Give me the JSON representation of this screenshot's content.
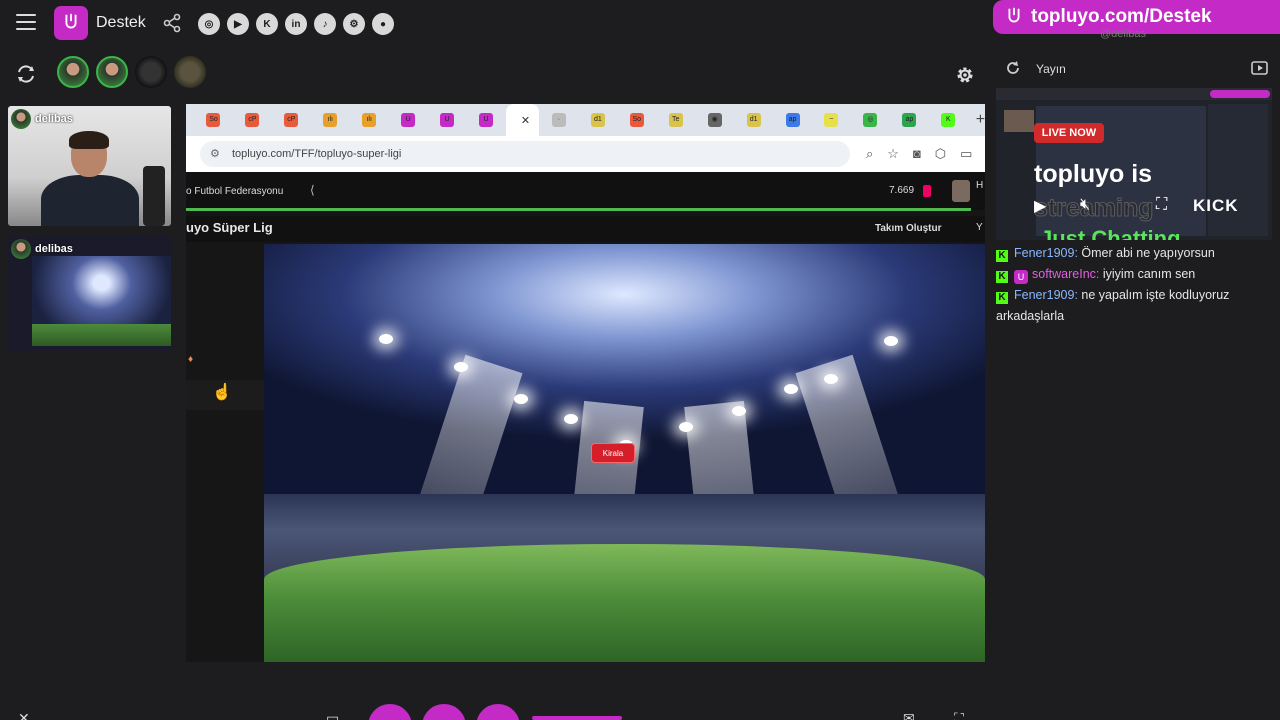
{
  "header": {
    "brand": "Destek",
    "social_icons": [
      "instagram-icon",
      "youtube-icon",
      "kick-icon",
      "linkedin-icon",
      "tiktok-icon",
      "steam-icon",
      "github-icon"
    ],
    "social_glyphs": [
      "◎",
      "▶",
      "K",
      "in",
      "♪",
      "⚙",
      "●"
    ]
  },
  "promo": {
    "text": "topluyo.com/Destek",
    "subtext": "@delibas"
  },
  "participants": {
    "cards": [
      {
        "name": "delibas"
      },
      {
        "name": "delibas"
      }
    ]
  },
  "browser": {
    "tabs": [
      "So",
      "cP",
      "cP",
      "ılı",
      "ılı",
      "U",
      "U",
      "U",
      "·",
      "d1",
      "So",
      "Te",
      "◉",
      "d1",
      "ap",
      "~",
      "◎",
      "ap",
      "K"
    ],
    "active_tab_close": "✕",
    "url": "topluyo.com/TFF/topluyo-super-ligi"
  },
  "site": {
    "org": "o Futbol Federasyonu",
    "count": "7.669",
    "user_initial": "H",
    "league": "uyo Süper Lig",
    "create_team": "Takım Oluştur",
    "create_team_cut": "Y",
    "rent_button": "Kirala",
    "progress": 1.0
  },
  "right_panel": {
    "title": "Yayın",
    "live_badge": "LIVE NOW",
    "stream_title": "topluyo is",
    "stream_sub": "streaming",
    "stream_category": "Just Chatting",
    "platform": "KICK"
  },
  "chat": [
    {
      "user": "Fener1909:",
      "text": "Ömer abi ne yapıyorsun",
      "sub": false
    },
    {
      "user": "softwareInc:",
      "text": "iyiyim canım sen",
      "sub": true
    },
    {
      "user": "Fener1909:",
      "text": "ne yapalım işte kodluyoruz arkadaşlarla",
      "sub": false
    }
  ],
  "colors": {
    "brand": "#c42ac6",
    "kick": "#53fc18",
    "live": "#d12a2a",
    "chat_user": "#8ab8ff",
    "progress": "#4fb84f"
  }
}
